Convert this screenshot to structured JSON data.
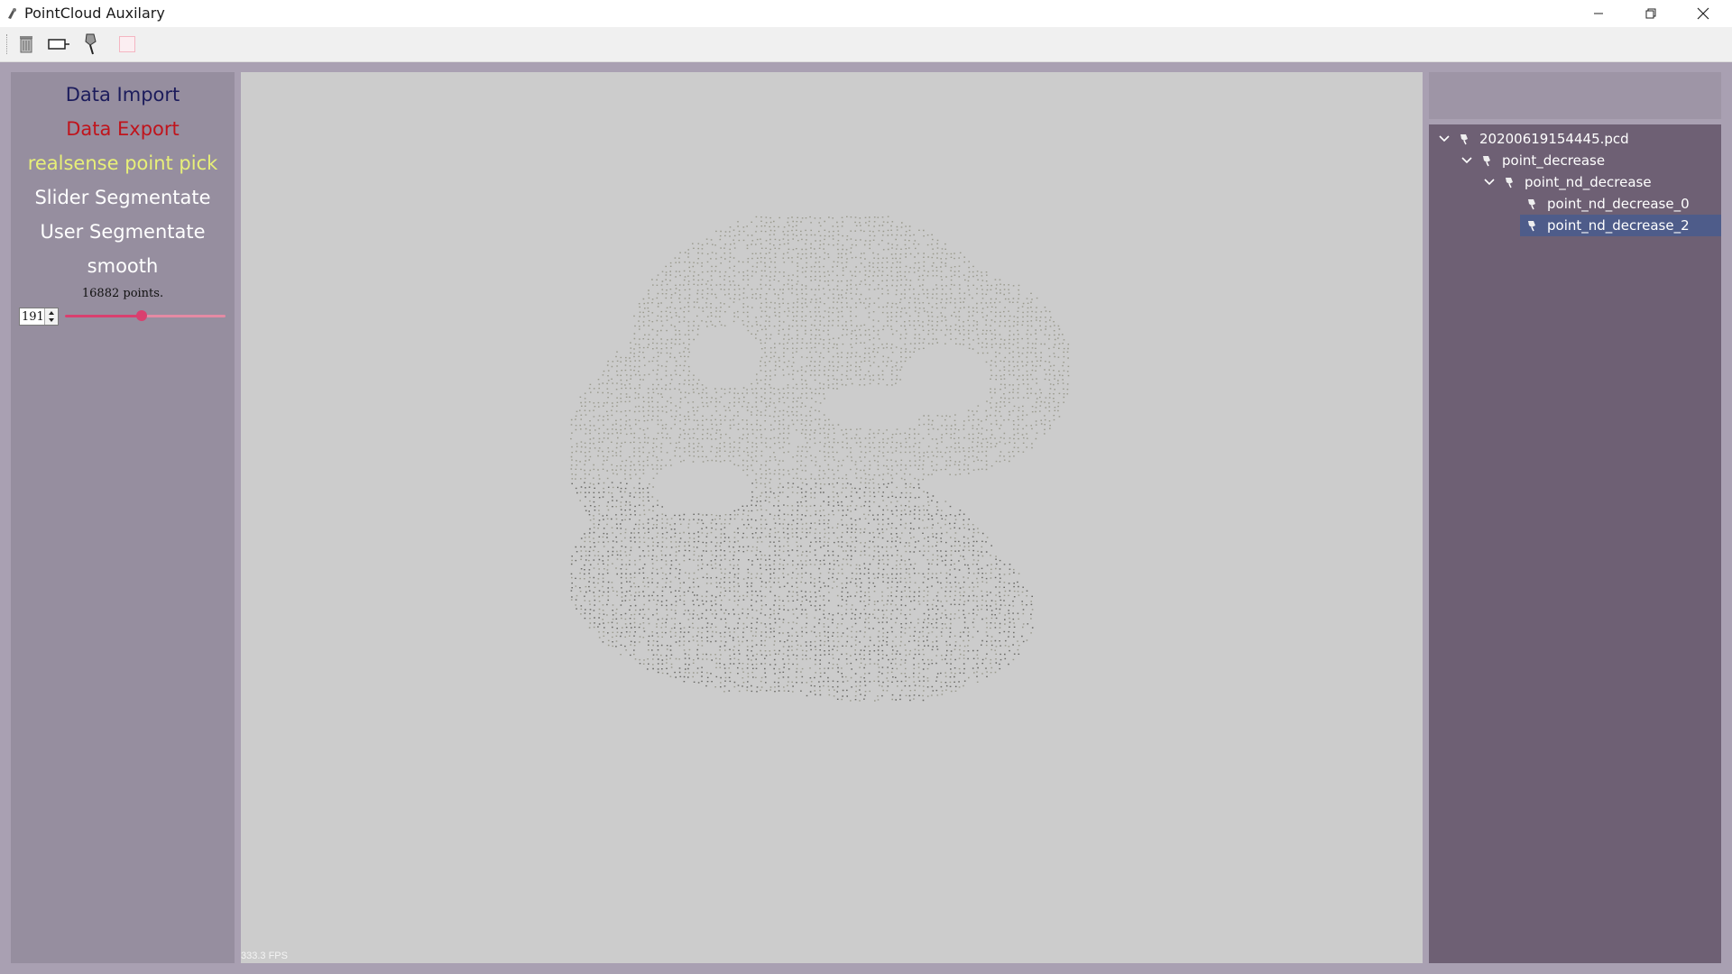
{
  "window": {
    "title": "PointCloud Auxilary",
    "controls": [
      "minimize",
      "restore",
      "close"
    ]
  },
  "toolbar": {
    "buttons": [
      {
        "name": "delete",
        "icon": "trash-icon"
      },
      {
        "name": "select-box",
        "icon": "rectangle-tool-icon"
      },
      {
        "name": "brush",
        "icon": "brush-icon"
      },
      {
        "name": "color",
        "icon": "color-swatch-icon",
        "color": "#f4b6c2"
      }
    ]
  },
  "left_panel": {
    "menu": [
      {
        "label": "Data Import",
        "color": "#1c1c5c"
      },
      {
        "label": "Data Export",
        "color": "#c0141c"
      },
      {
        "label": "realsense point pick",
        "color": "#e8f078"
      },
      {
        "label": "Slider Segmentate",
        "color": "#ffffff"
      },
      {
        "label": "User Segmentate",
        "color": "#ffffff"
      },
      {
        "label": "smooth",
        "color": "#ffffff"
      }
    ],
    "points_label": "16882 points.",
    "spin_value": "191",
    "slider_fraction": 0.48
  },
  "viewport": {
    "fps": "333.3 FPS"
  },
  "tree": {
    "nodes": [
      {
        "label": "20200619154445.pcd",
        "depth": 0,
        "expanded": true,
        "selected": false
      },
      {
        "label": "point_decrease",
        "depth": 1,
        "expanded": true,
        "selected": false
      },
      {
        "label": "point_nd_decrease",
        "depth": 2,
        "expanded": true,
        "selected": false
      },
      {
        "label": "point_nd_decrease_0",
        "depth": 3,
        "expanded": false,
        "selected": false
      },
      {
        "label": "point_nd_decrease_2",
        "depth": 3,
        "expanded": false,
        "selected": true
      }
    ]
  },
  "colors": {
    "background": "#a9a0b2",
    "left_panel": "#968e9f",
    "viewport": "#cccccc",
    "tree_panel": "#6e6074",
    "selection": "#4e5c8a",
    "slider": "#d9406f"
  }
}
